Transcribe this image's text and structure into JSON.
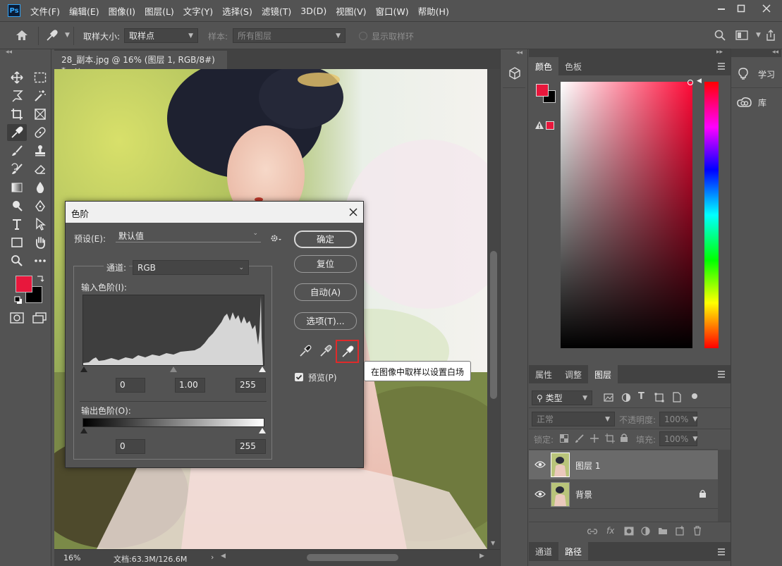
{
  "app": {
    "logo": "Ps"
  },
  "menu": [
    "文件(F)",
    "编辑(E)",
    "图像(I)",
    "图层(L)",
    "文字(Y)",
    "选择(S)",
    "滤镜(T)",
    "3D(D)",
    "视图(V)",
    "窗口(W)",
    "帮助(H)"
  ],
  "options": {
    "sample_size_label": "取样大小:",
    "sample_size_value": "取样点",
    "sample_label": "样本:",
    "sample_value": "所有图层",
    "show_ring_label": "显示取样环"
  },
  "document": {
    "tab_title": "28_副本.jpg @ 16% (图层 1, RGB/8#) *",
    "zoom": "16%",
    "doc_size": "文档:63.3M/126.6M"
  },
  "color_panel": {
    "tabs": [
      "颜色",
      "色板"
    ],
    "fg_color": "#e8173c",
    "bg_color": "#000000"
  },
  "learn_panel": {
    "learn_label": "学习",
    "library_label": "库"
  },
  "layers_panel": {
    "tabs": [
      "属性",
      "调整",
      "图层"
    ],
    "filter_kind": "类型",
    "blend_mode": "正常",
    "opacity_label": "不透明度:",
    "opacity_value": "100%",
    "lock_label": "锁定:",
    "fill_label": "填充:",
    "fill_value": "100%",
    "layers": [
      {
        "name": "图层 1",
        "selected": true,
        "locked": false
      },
      {
        "name": "背景",
        "selected": false,
        "locked": true
      }
    ]
  },
  "bottom_tabs": [
    "通道",
    "路径"
  ],
  "levels_dialog": {
    "title": "色阶",
    "preset_label": "预设(E):",
    "preset_value": "默认值",
    "channel_label": "通道:",
    "channel_value": "RGB",
    "input_levels_label": "输入色阶(I):",
    "input_black": "0",
    "input_gamma": "1.00",
    "input_white": "255",
    "output_levels_label": "输出色阶(O):",
    "output_black": "0",
    "output_white": "255",
    "ok_label": "确定",
    "reset_label": "复位",
    "auto_label": "自动(A)",
    "options_label": "选项(T)...",
    "preview_label": "预览(P)",
    "preview_checked": true,
    "tooltip": "在图像中取样以设置白场"
  }
}
